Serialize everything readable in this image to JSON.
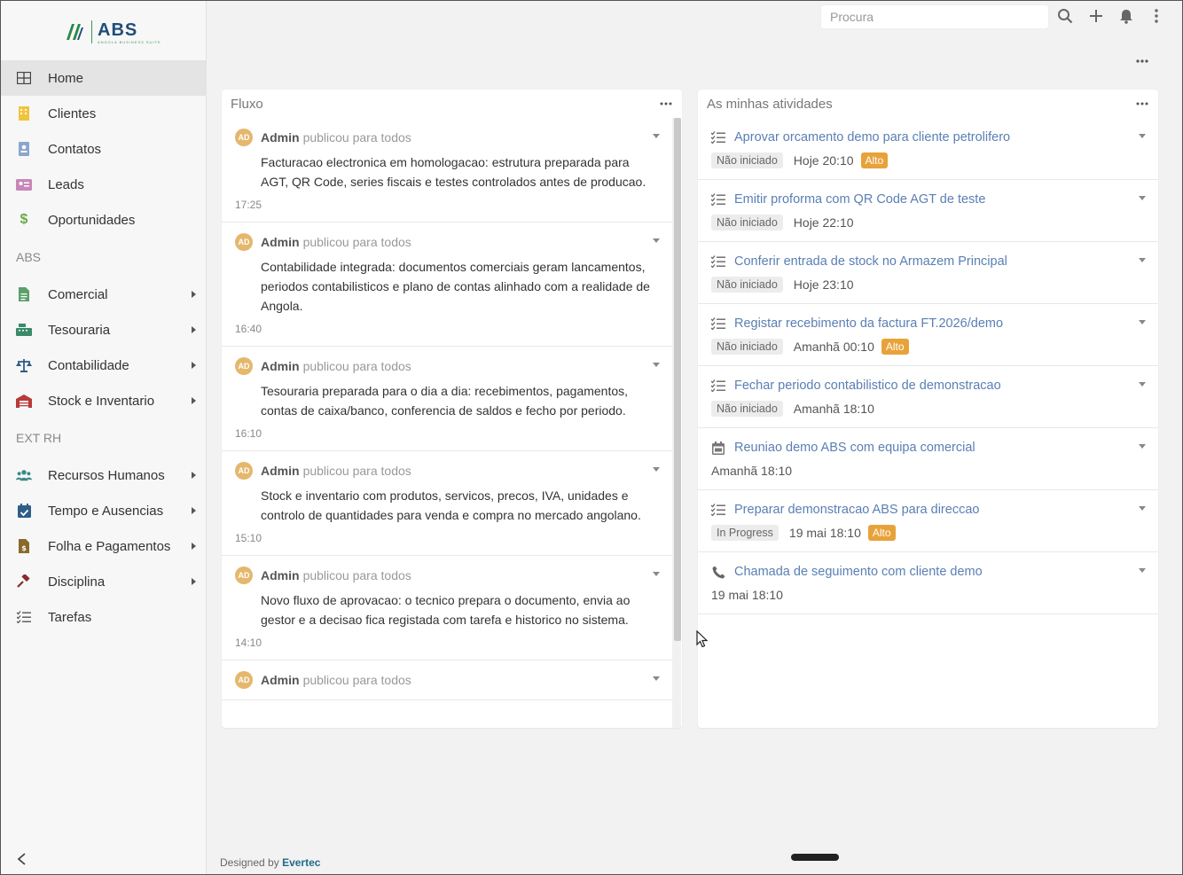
{
  "logo": {
    "text": "ABS",
    "tagline": "ANGOLA BUSINESS SUITE"
  },
  "sidebar": {
    "items": [
      {
        "label": "Home",
        "icon": "grid-icon",
        "active": true
      },
      {
        "label": "Clientes",
        "icon": "building-icon"
      },
      {
        "label": "Contatos",
        "icon": "contact-card-icon"
      },
      {
        "label": "Leads",
        "icon": "id-card-icon"
      },
      {
        "label": "Oportunidades",
        "icon": "dollar-icon"
      }
    ],
    "group_abs": "ABS",
    "abs_items": [
      {
        "label": "Comercial",
        "icon": "document-icon"
      },
      {
        "label": "Tesouraria",
        "icon": "cash-register-icon"
      },
      {
        "label": "Contabilidade",
        "icon": "scale-icon"
      },
      {
        "label": "Stock e Inventario",
        "icon": "warehouse-icon"
      }
    ],
    "group_ext": "EXT RH",
    "ext_items": [
      {
        "label": "Recursos Humanos",
        "icon": "users-icon"
      },
      {
        "label": "Tempo e Ausencias",
        "icon": "calendar-check-icon"
      },
      {
        "label": "Folha e Pagamentos",
        "icon": "payroll-icon"
      },
      {
        "label": "Disciplina",
        "icon": "gavel-icon"
      },
      {
        "label": "Tarefas",
        "icon": "tasks-icon"
      }
    ]
  },
  "search": {
    "placeholder": "Procura"
  },
  "feed": {
    "title": "Fluxo",
    "items": [
      {
        "author": "Admin",
        "action": "publicou para todos",
        "initials": "AD",
        "body": "Facturacao electronica em homologacao: estrutura preparada para AGT, QR Code, series fiscais e testes controlados antes de producao.",
        "time": "17:25"
      },
      {
        "author": "Admin",
        "action": "publicou para todos",
        "initials": "AD",
        "body": "Contabilidade integrada: documentos comerciais geram lancamentos, periodos contabilisticos e plano de contas alinhado com a realidade de Angola.",
        "time": "16:40"
      },
      {
        "author": "Admin",
        "action": "publicou para todos",
        "initials": "AD",
        "body": "Tesouraria preparada para o dia a dia: recebimentos, pagamentos, contas de caixa/banco, conferencia de saldos e fecho por periodo.",
        "time": "16:10"
      },
      {
        "author": "Admin",
        "action": "publicou para todos",
        "initials": "AD",
        "body": "Stock e inventario com produtos, servicos, precos, IVA, unidades e controlo de quantidades para venda e compra no mercado angolano.",
        "time": "15:10"
      },
      {
        "author": "Admin",
        "action": "publicou para todos",
        "initials": "AD",
        "body": "Novo fluxo de aprovacao: o tecnico prepara o documento, envia ao gestor e a decisao fica registada com tarefa e historico no sistema.",
        "time": "14:10"
      },
      {
        "author": "Admin",
        "action": "publicou para todos",
        "initials": "AD",
        "body": "",
        "time": ""
      }
    ]
  },
  "activities": {
    "title": "As minhas atividades",
    "items": [
      {
        "type": "task",
        "title": "Aprovar orcamento demo para cliente petrolifero",
        "status": "Não iniciado",
        "date": "Hoje 20:10",
        "priority": "Alto"
      },
      {
        "type": "task",
        "title": "Emitir proforma com QR Code AGT de teste",
        "status": "Não iniciado",
        "date": "Hoje 22:10",
        "priority": ""
      },
      {
        "type": "task",
        "title": "Conferir entrada de stock no Armazem Principal",
        "status": "Não iniciado",
        "date": "Hoje 23:10",
        "priority": ""
      },
      {
        "type": "task",
        "title": "Registar recebimento da factura FT.2026/demo",
        "status": "Não iniciado",
        "date": "Amanhã 00:10",
        "priority": "Alto"
      },
      {
        "type": "task",
        "title": "Fechar periodo contabilistico de demonstracao",
        "status": "Não iniciado",
        "date": "Amanhã 18:10",
        "priority": ""
      },
      {
        "type": "meeting",
        "title": "Reuniao demo ABS com equipa comercial",
        "status": "",
        "date": "Amanhã 18:10",
        "priority": ""
      },
      {
        "type": "task",
        "title": "Preparar demonstracao ABS para direccao",
        "status": "In Progress",
        "date": "19 mai 18:10",
        "priority": "Alto"
      },
      {
        "type": "call",
        "title": "Chamada de seguimento com cliente demo",
        "status": "",
        "date": "19 mai 18:10",
        "priority": ""
      }
    ]
  },
  "footer": {
    "prefix": "Designed by",
    "brand": "Evertec"
  },
  "colors": {
    "accent": "#5a7fb4",
    "priority": "#e8a23a",
    "avatar": "#e5b76d",
    "brand_green": "#3a9a5a",
    "brand_blue": "#1f4e79"
  }
}
